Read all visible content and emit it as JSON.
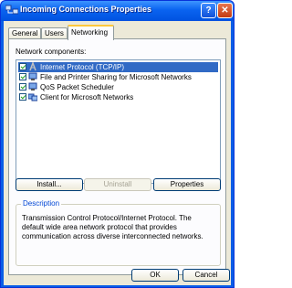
{
  "window": {
    "title": "Incoming Connections Properties"
  },
  "titlebar_buttons": {
    "help": "?",
    "close": "✕"
  },
  "tabs": [
    {
      "label": "General"
    },
    {
      "label": "Users"
    },
    {
      "label": "Networking"
    }
  ],
  "networking": {
    "components_label": "Network components:",
    "components": [
      {
        "label": "Internet Protocol (TCP/IP)",
        "checked": true,
        "selected": true,
        "icon": "protocol-icon"
      },
      {
        "label": "File and Printer Sharing for Microsoft Networks",
        "checked": true,
        "selected": false,
        "icon": "network-service-icon"
      },
      {
        "label": "QoS Packet Scheduler",
        "checked": true,
        "selected": false,
        "icon": "network-service-icon"
      },
      {
        "label": "Client for Microsoft Networks",
        "checked": true,
        "selected": false,
        "icon": "network-client-icon"
      }
    ],
    "buttons": {
      "install": "Install...",
      "uninstall": "Uninstall",
      "properties": "Properties"
    },
    "description_title": "Description",
    "description_text": "Transmission Control Protocol/Internet Protocol. The default wide area network protocol that provides communication across diverse interconnected networks."
  },
  "footer": {
    "ok": "OK",
    "cancel": "Cancel"
  },
  "colors": {
    "accent": "#0a5ee6",
    "selection": "#316ac5",
    "group_title": "#0046d5"
  }
}
